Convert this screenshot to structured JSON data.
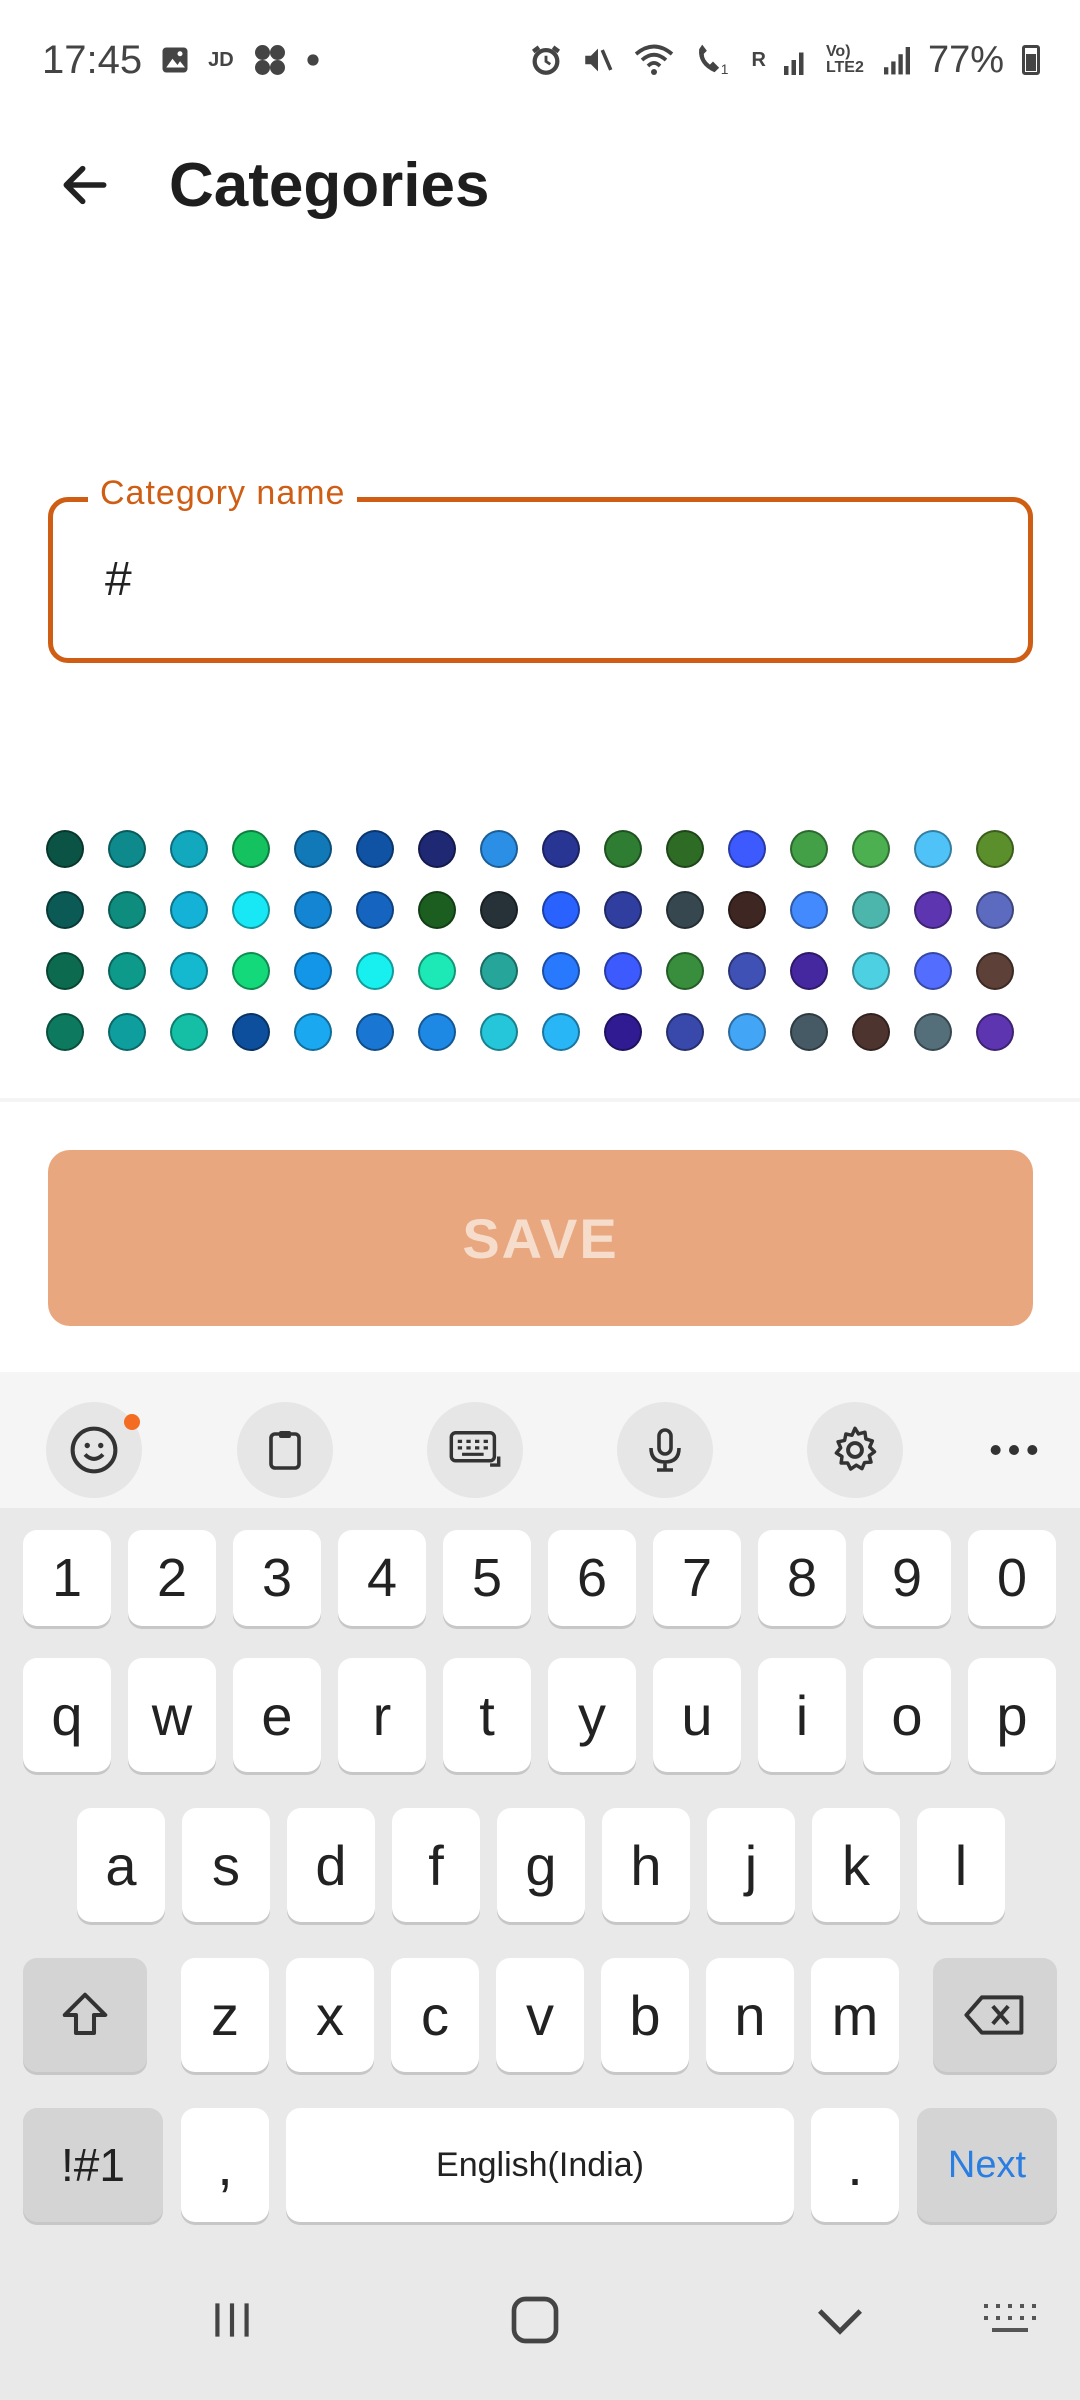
{
  "status_bar": {
    "time": "17:45",
    "jio_label": "JD",
    "battery": "77%",
    "volte_label": "Vo) LTE2",
    "signal_label": "R"
  },
  "app_bar": {
    "title": "Categories",
    "back_icon": "arrow-left-icon"
  },
  "category_field": {
    "label": "Category name",
    "value": "#"
  },
  "colors": [
    "#0b5445",
    "#0e8a8c",
    "#12a9bf",
    "#14c25f",
    "#1279b8",
    "#1052a4",
    "#1e2873",
    "#2b8fe6",
    "#283593",
    "#2e7d32",
    "#2e6b25",
    "#3d5afe",
    "#43a047",
    "#4caf50",
    "#4fc3f7",
    "#5a8f2b",
    "#0b5a55",
    "#0e8c7d",
    "#14b2d6",
    "#18e8f5",
    "#1485d2",
    "#1565c0",
    "#1b5e20",
    "#263238",
    "#2962ff",
    "#303f9f",
    "#37474f",
    "#3e2723",
    "#448aff",
    "#4db6ac",
    "#5e35b1",
    "#5c6bc0",
    "#0c6b4f",
    "#0e9a8a",
    "#14b8cf",
    "#14d97a",
    "#1396e8",
    "#18f0f0",
    "#1de9b6",
    "#26a69a",
    "#2979ff",
    "#3d5afe",
    "#388e3c",
    "#3f51b5",
    "#4527a0",
    "#4dd0e1",
    "#536dfe",
    "#5d4037",
    "#0d7a5f",
    "#0e9e9e",
    "#14bfa6",
    "#0d4f9c",
    "#1aa8f0",
    "#1976d2",
    "#1e88e5",
    "#26c6da",
    "#29b6f6",
    "#311b92",
    "#3949ab",
    "#42a5f5",
    "#455a64",
    "#4e342e",
    "#546e7a",
    "#5e35b1"
  ],
  "save_button": {
    "label": "SAVE"
  },
  "keyboard": {
    "toolbar": [
      "emoji-icon",
      "clipboard-icon",
      "keyboard-icon",
      "microphone-icon",
      "settings-icon",
      "more-icon"
    ],
    "row_numbers": [
      "1",
      "2",
      "3",
      "4",
      "5",
      "6",
      "7",
      "8",
      "9",
      "0"
    ],
    "row_1": [
      "q",
      "w",
      "e",
      "r",
      "t",
      "y",
      "u",
      "i",
      "o",
      "p"
    ],
    "row_2": [
      "a",
      "s",
      "d",
      "f",
      "g",
      "h",
      "j",
      "k",
      "l"
    ],
    "row_3": [
      "z",
      "x",
      "c",
      "v",
      "b",
      "n",
      "m"
    ],
    "symbols_label": "!#1",
    "comma_label": ",",
    "space_label": "English(India)",
    "period_label": ".",
    "next_label": "Next"
  }
}
